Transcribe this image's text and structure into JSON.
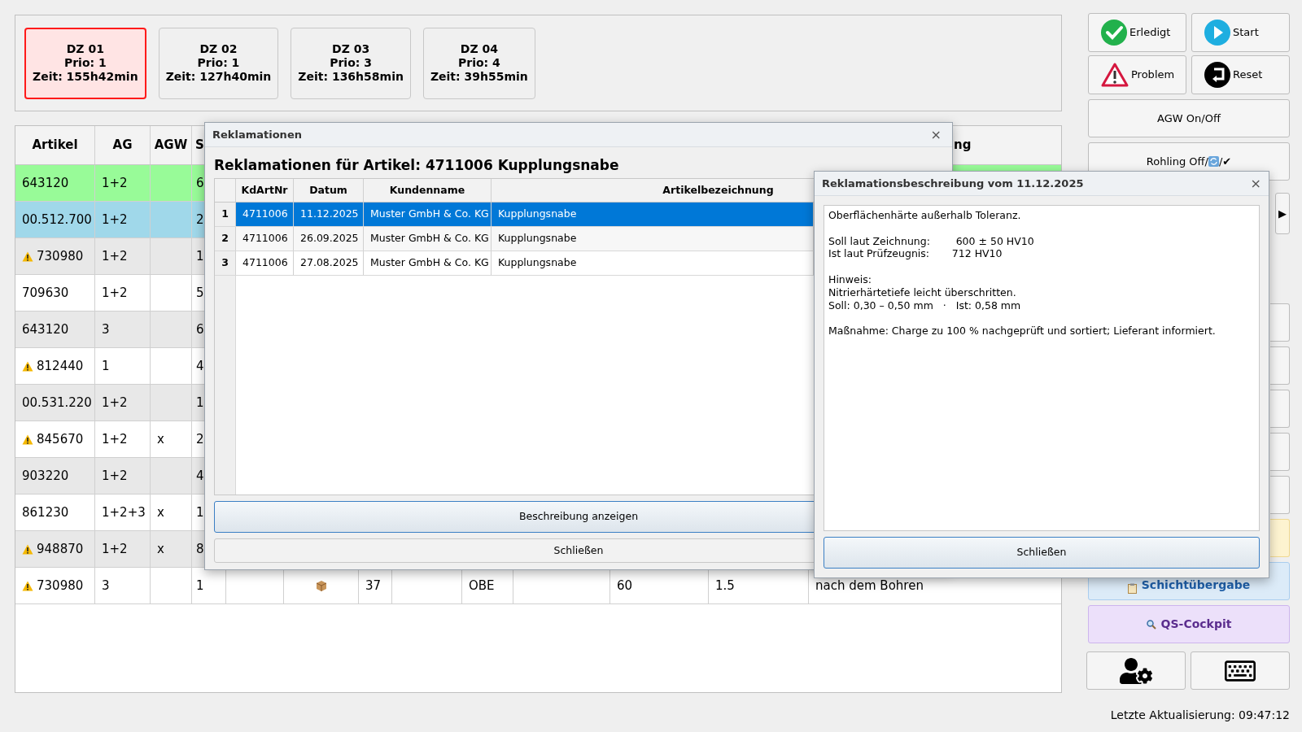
{
  "dz_cards": [
    {
      "title": "DZ 01",
      "prio": "Prio: 1",
      "zeit": "Zeit: 155h42min",
      "selected": true
    },
    {
      "title": "DZ 02",
      "prio": "Prio: 1",
      "zeit": "Zeit: 127h40min",
      "selected": false
    },
    {
      "title": "DZ 03",
      "prio": "Prio: 3",
      "zeit": "Zeit: 136h58min",
      "selected": false
    },
    {
      "title": "DZ 04",
      "prio": "Prio: 4",
      "zeit": "Zeit: 39h55min",
      "selected": false
    }
  ],
  "table": {
    "columns": [
      "Artikel",
      "AG",
      "AGW",
      "S",
      null,
      null,
      null,
      null,
      null,
      null,
      null,
      null,
      "ng"
    ],
    "rows": [
      {
        "warning": false,
        "color": "#98fb98",
        "cells": [
          "643120",
          "1+2",
          null,
          "6"
        ]
      },
      {
        "warning": false,
        "color": "#a0d8ea",
        "cells": [
          "00.512.700",
          "1+2",
          null,
          "2"
        ]
      },
      {
        "warning": true,
        "cells": [
          "730980",
          "1+2",
          null,
          "1"
        ]
      },
      {
        "warning": false,
        "cells": [
          "709630",
          "1+2",
          null,
          "5"
        ]
      },
      {
        "warning": false,
        "cells": [
          "643120",
          "3",
          null,
          "6"
        ]
      },
      {
        "warning": true,
        "cells": [
          "812440",
          "1",
          null,
          "4"
        ]
      },
      {
        "warning": false,
        "cells": [
          "00.531.220",
          "1+2",
          null,
          "1"
        ]
      },
      {
        "warning": true,
        "cells": [
          "845670",
          "1+2",
          "x",
          "2"
        ]
      },
      {
        "warning": false,
        "cells": [
          "903220",
          "1+2",
          null,
          "4"
        ]
      },
      {
        "warning": false,
        "cells": [
          "861230",
          "1+2+3",
          "x",
          "1"
        ]
      },
      {
        "warning": true,
        "cells": [
          "948870",
          "1+2",
          "x",
          "8"
        ]
      },
      {
        "warning": true,
        "package_icon": true,
        "cells": [
          "730980",
          "3",
          null,
          "1",
          null,
          null,
          "37",
          null,
          "OBE",
          null,
          "60",
          "1.5",
          "nach dem Bohren"
        ]
      }
    ]
  },
  "actions": [
    {
      "label": "Erledigt",
      "kind": "check"
    },
    {
      "label": "Start",
      "kind": "play"
    },
    {
      "label": "Problem",
      "kind": "warning"
    },
    {
      "label": "Reset",
      "kind": "reset"
    }
  ],
  "toggles": [
    {
      "label": "AGW On/Off",
      "kind": "plain"
    },
    {
      "label": "Rohling Off/",
      "kind": "refresh",
      "suffix": "/✔"
    }
  ],
  "arrow_button": "▶",
  "shift_button": {
    "label": "Schichtübergabe"
  },
  "qs_button": {
    "label": "QS-Cockpit"
  },
  "status": "Letzte Aktualisierung: 09:47:12",
  "complaints_dialog": {
    "title": "Reklamationen",
    "close": "×",
    "heading": "Reklamationen für Artikel: 4711006 Kupplungsnabe",
    "columns": [
      "KdArtNr",
      "Datum",
      "Kundenname",
      "Artikelbezeichnung"
    ],
    "rows": [
      {
        "number": "1",
        "selected": true,
        "cells": [
          "4711006",
          "11.12.2025",
          "Muster GmbH & Co. KG",
          "Kupplungsnabe"
        ]
      },
      {
        "number": "2",
        "selected": false,
        "cells": [
          "4711006",
          "26.09.2025",
          "Muster GmbH & Co. KG",
          "Kupplungsnabe"
        ]
      },
      {
        "number": "3",
        "selected": false,
        "cells": [
          "4711006",
          "27.08.2025",
          "Muster GmbH & Co. KG",
          "Kupplungsnabe"
        ]
      }
    ],
    "buttons": [
      "Beschreibung anzeigen",
      "Schließen"
    ]
  },
  "description_dialog": {
    "title": "Reklamationsbeschreibung vom 11.12.2025",
    "close": "×",
    "text": "Oberflächenhärte außerhalb Toleranz.\n\nSoll laut Zeichnung:        600 ± 50 HV10\nIst laut Prüfzeugnis:       712 HV10\n\nHinweis:\nNitrierhärtetiefe leicht überschritten.\nSoll: 0,30 – 0,50 mm   ·   Ist: 0,58 mm\n\nMaßnahme: Charge zu 100 % nachgeprüft und sortiert; Lieferant informiert.",
    "button": "Schließen"
  }
}
